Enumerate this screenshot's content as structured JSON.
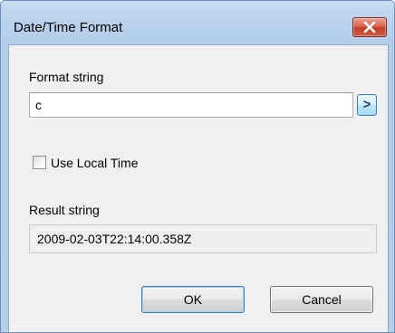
{
  "window": {
    "title": "Date/Time Format"
  },
  "format": {
    "label": "Format string",
    "value": "c",
    "apply_label": ">"
  },
  "local_time": {
    "label": "Use Local Time",
    "checked": false
  },
  "result": {
    "label": "Result string",
    "value": "2009-02-03T22:14:00.358Z"
  },
  "buttons": {
    "ok_label": "OK",
    "cancel_label": "Cancel"
  },
  "colors": {
    "titlebar": "#c7dcf2",
    "client_bg": "#f0f0f0",
    "close_button": "#c2402a",
    "accent": "#3c7fb1"
  },
  "icons": {
    "close": "close-icon"
  }
}
